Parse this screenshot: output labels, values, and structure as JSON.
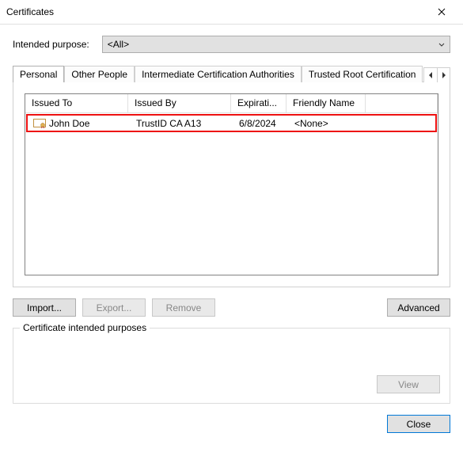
{
  "window": {
    "title": "Certificates"
  },
  "purpose": {
    "label": "Intended purpose:",
    "selected": "<All>"
  },
  "tabs": [
    {
      "label": "Personal"
    },
    {
      "label": "Other People"
    },
    {
      "label": "Intermediate Certification Authorities"
    },
    {
      "label": "Trusted Root Certification"
    }
  ],
  "list": {
    "headers": [
      "Issued To",
      "Issued By",
      "Expirati...",
      "Friendly Name"
    ],
    "rows": [
      {
        "issued_to": "John Doe",
        "issued_by": "TrustID CA A13",
        "expiration": "6/8/2024",
        "friendly": "<None>"
      }
    ]
  },
  "buttons": {
    "import": "Import...",
    "export": "Export...",
    "remove": "Remove",
    "advanced": "Advanced",
    "view": "View",
    "close": "Close"
  },
  "group": {
    "legend": "Certificate intended purposes"
  }
}
